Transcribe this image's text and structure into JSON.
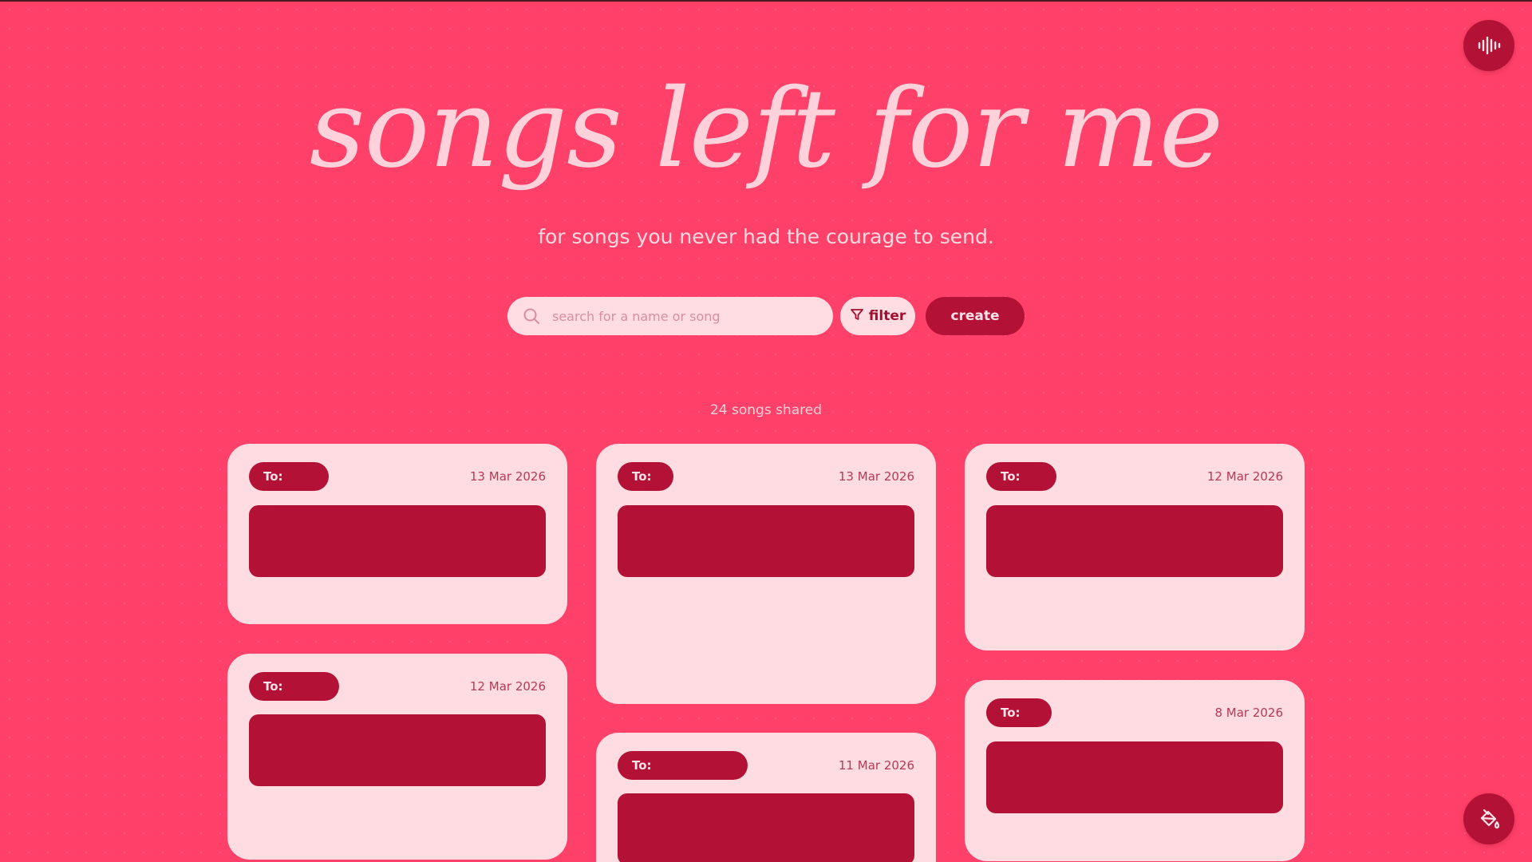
{
  "header": {
    "title": "songs left for me",
    "subtitle": "for songs you never had the courage to send."
  },
  "search": {
    "placeholder": "search for a name or song",
    "icon": "search-icon"
  },
  "toolbar": {
    "filter_label": "filter",
    "create_label": "create"
  },
  "count_label": "24 songs shared",
  "fabs": {
    "top_icon": "audio-wave-icon",
    "bottom_icon": "paint-bucket-icon"
  },
  "cards": [
    {
      "to_label": "To:",
      "date": "13 Mar 2026"
    },
    {
      "to_label": "To:",
      "date": "13 Mar 2026"
    },
    {
      "to_label": "To:",
      "date": "12 Mar 2026"
    },
    {
      "to_label": "To:",
      "date": "12 Mar 2026"
    },
    {
      "to_label": "To:",
      "date": "11 Mar 2026"
    },
    {
      "to_label": "To:",
      "date": "8 Mar 2026"
    }
  ],
  "colors": {
    "background": "#ff4068",
    "card": "#ffdce2",
    "accent": "#b31236",
    "title": "#ffd1da"
  }
}
